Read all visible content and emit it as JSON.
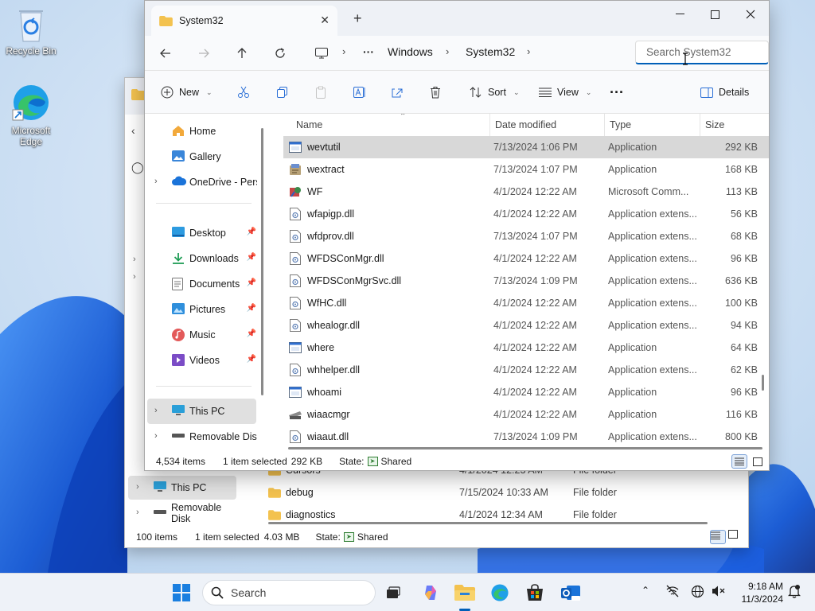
{
  "desktop": {
    "icons": [
      {
        "label": "Recycle Bin"
      },
      {
        "label": "Microsoft Edge"
      }
    ]
  },
  "background_window": {
    "nav": [
      {
        "label": "This PC"
      },
      {
        "label": "Removable Disk"
      }
    ],
    "rows": [
      {
        "name": "Cursors",
        "date": "4/1/2024 12:23 AM",
        "type": "File folder"
      },
      {
        "name": "debug",
        "date": "7/15/2024 10:33 AM",
        "type": "File folder"
      },
      {
        "name": "diagnostics",
        "date": "4/1/2024 12:34 AM",
        "type": "File folder"
      }
    ],
    "status": {
      "items": "100 items",
      "selected": "1 item selected",
      "size": "4.03 MB",
      "state_label": "State:",
      "state_value": "Shared"
    }
  },
  "window": {
    "tab_title": "System32",
    "new_tab": "+",
    "breadcrumb": [
      "Windows",
      "System32"
    ],
    "breadcrumb_more": "···",
    "search_placeholder": "Search System32",
    "commands": {
      "new": "New",
      "sort": "Sort",
      "view": "View",
      "more": "···",
      "details": "Details"
    },
    "nav": [
      {
        "label": "Home",
        "icon": "home-icon"
      },
      {
        "label": "Gallery",
        "icon": "gallery-icon"
      },
      {
        "label": "OneDrive - Perso",
        "icon": "cloud-icon"
      },
      {
        "label": "Desktop",
        "icon": "desktop-folder-icon",
        "pinned": true
      },
      {
        "label": "Downloads",
        "icon": "download-icon",
        "pinned": true
      },
      {
        "label": "Documents",
        "icon": "documents-icon",
        "pinned": true
      },
      {
        "label": "Pictures",
        "icon": "pictures-icon",
        "pinned": true
      },
      {
        "label": "Music",
        "icon": "music-icon",
        "pinned": true
      },
      {
        "label": "Videos",
        "icon": "videos-icon",
        "pinned": true
      },
      {
        "label": "This PC",
        "icon": "pc-icon"
      },
      {
        "label": "Removable Disk",
        "icon": "drive-icon"
      }
    ],
    "columns": [
      "Name",
      "Date modified",
      "Type",
      "Size"
    ],
    "files": [
      {
        "name": "wevtutil",
        "date": "7/13/2024 1:06 PM",
        "type": "Application",
        "size": "292 KB",
        "icon": "app"
      },
      {
        "name": "wextract",
        "date": "7/13/2024 1:07 PM",
        "type": "Application",
        "size": "168 KB",
        "icon": "installer"
      },
      {
        "name": "WF",
        "date": "4/1/2024 12:22 AM",
        "type": "Microsoft Comm...",
        "size": "113 KB",
        "icon": "msc"
      },
      {
        "name": "wfapigp.dll",
        "date": "4/1/2024 12:22 AM",
        "type": "Application extens...",
        "size": "56 KB",
        "icon": "dll"
      },
      {
        "name": "wfdprov.dll",
        "date": "7/13/2024 1:07 PM",
        "type": "Application extens...",
        "size": "68 KB",
        "icon": "dll"
      },
      {
        "name": "WFDSConMgr.dll",
        "date": "4/1/2024 12:22 AM",
        "type": "Application extens...",
        "size": "96 KB",
        "icon": "dll"
      },
      {
        "name": "WFDSConMgrSvc.dll",
        "date": "7/13/2024 1:09 PM",
        "type": "Application extens...",
        "size": "636 KB",
        "icon": "dll"
      },
      {
        "name": "WfHC.dll",
        "date": "4/1/2024 12:22 AM",
        "type": "Application extens...",
        "size": "100 KB",
        "icon": "dll"
      },
      {
        "name": "whealogr.dll",
        "date": "4/1/2024 12:22 AM",
        "type": "Application extens...",
        "size": "94 KB",
        "icon": "dll"
      },
      {
        "name": "where",
        "date": "4/1/2024 12:22 AM",
        "type": "Application",
        "size": "64 KB",
        "icon": "app"
      },
      {
        "name": "whhelper.dll",
        "date": "4/1/2024 12:22 AM",
        "type": "Application extens...",
        "size": "62 KB",
        "icon": "dll"
      },
      {
        "name": "whoami",
        "date": "4/1/2024 12:22 AM",
        "type": "Application",
        "size": "96 KB",
        "icon": "app"
      },
      {
        "name": "wiaacmgr",
        "date": "4/1/2024 12:22 AM",
        "type": "Application",
        "size": "116 KB",
        "icon": "scanner"
      },
      {
        "name": "wiaaut.dll",
        "date": "7/13/2024 1:09 PM",
        "type": "Application extens...",
        "size": "800 KB",
        "icon": "dll"
      }
    ],
    "selected_file_index": 0,
    "status": {
      "items": "4,534 items",
      "selected": "1 item selected",
      "size": "292 KB",
      "state_label": "State:",
      "state_value": "Shared"
    }
  },
  "taskbar": {
    "search_label": "Search",
    "time": "9:18 AM",
    "date": "11/3/2024"
  },
  "colors": {
    "accent": "#005fb8",
    "selection": "#d8d8d8",
    "folder": "#f3c24f"
  }
}
